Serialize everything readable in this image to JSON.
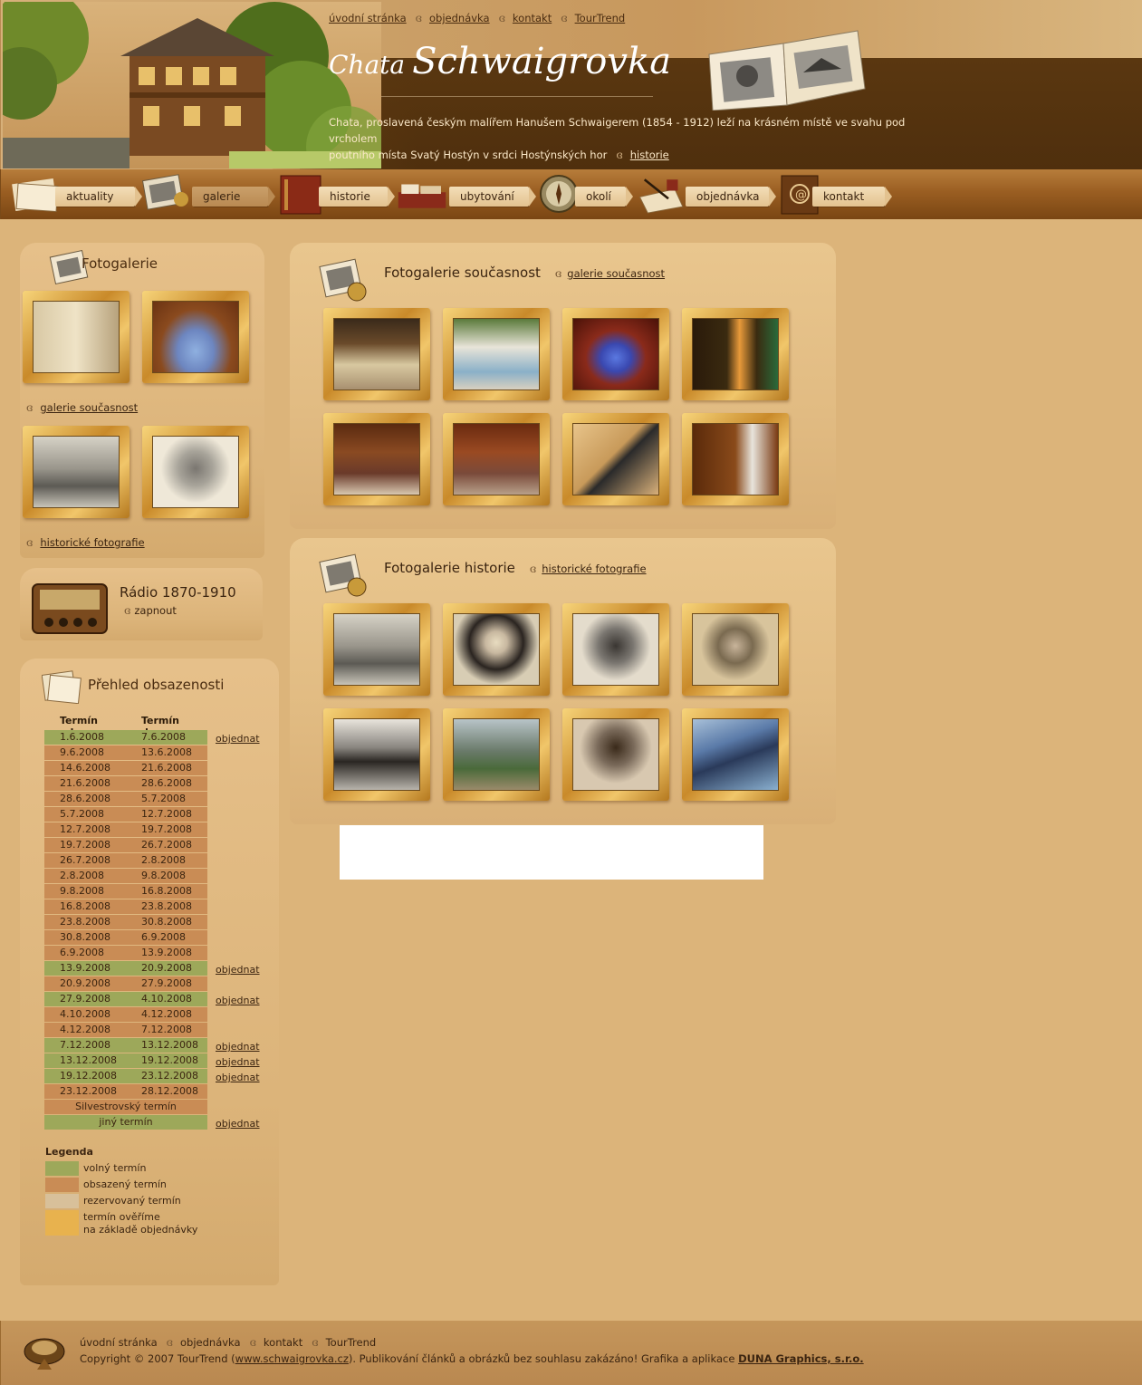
{
  "header": {
    "top_links": [
      "úvodní stránka",
      "objednávka",
      "kontakt",
      "TourTrend"
    ],
    "title_small": "Chata",
    "title_large": "Schwaigrovka",
    "intro_line1": "Chata, proslavená českým malířem Hanušem Schwaigerem (1854 - 1912) leží na krásném místě ve svahu pod vrcholem",
    "intro_line2": "poutního místa Svatý Hostýn v srdci Hostýnských hor",
    "intro_link": "historie"
  },
  "nav": [
    {
      "label": "aktuality",
      "icon": "papers-icon"
    },
    {
      "label": "galerie",
      "icon": "photos-icon",
      "active": true
    },
    {
      "label": "historie",
      "icon": "book-icon"
    },
    {
      "label": "ubytování",
      "icon": "bed-icon"
    },
    {
      "label": "okolí",
      "icon": "compass-icon"
    },
    {
      "label": "objednávka",
      "icon": "quill-icon"
    },
    {
      "label": "kontakt",
      "icon": "address-book-icon"
    }
  ],
  "sidebar": {
    "gallery_title": "Fotogalerie",
    "gallery_link_present": "galerie současnost",
    "gallery_link_history": "historické fotografie",
    "radio_title": "Rádio 1870-1910",
    "radio_action": "zapnout",
    "occupancy_title": "Přehled obsazenosti",
    "col_from": "Termín od",
    "col_to": "Termín do",
    "order_label": "objednat",
    "rows": [
      {
        "from": "1.6.2008",
        "to": "7.6.2008",
        "free": true
      },
      {
        "from": "9.6.2008",
        "to": "13.6.2008",
        "free": false
      },
      {
        "from": "14.6.2008",
        "to": "21.6.2008",
        "free": false
      },
      {
        "from": "21.6.2008",
        "to": "28.6.2008",
        "free": false
      },
      {
        "from": "28.6.2008",
        "to": "5.7.2008",
        "free": false
      },
      {
        "from": "5.7.2008",
        "to": "12.7.2008",
        "free": false
      },
      {
        "from": "12.7.2008",
        "to": "19.7.2008",
        "free": false
      },
      {
        "from": "19.7.2008",
        "to": "26.7.2008",
        "free": false
      },
      {
        "from": "26.7.2008",
        "to": "2.8.2008",
        "free": false
      },
      {
        "from": "2.8.2008",
        "to": "9.8.2008",
        "free": false
      },
      {
        "from": "9.8.2008",
        "to": "16.8.2008",
        "free": false
      },
      {
        "from": "16.8.2008",
        "to": "23.8.2008",
        "free": false
      },
      {
        "from": "23.8.2008",
        "to": "30.8.2008",
        "free": false
      },
      {
        "from": "30.8.2008",
        "to": "6.9.2008",
        "free": false
      },
      {
        "from": "6.9.2008",
        "to": "13.9.2008",
        "free": false
      },
      {
        "from": "13.9.2008",
        "to": "20.9.2008",
        "free": true
      },
      {
        "from": "20.9.2008",
        "to": "27.9.2008",
        "free": false
      },
      {
        "from": "27.9.2008",
        "to": "4.10.2008",
        "free": true
      },
      {
        "from": "4.10.2008",
        "to": "4.12.2008",
        "free": false
      },
      {
        "from": "4.12.2008",
        "to": "7.12.2008",
        "free": false
      },
      {
        "from": "7.12.2008",
        "to": "13.12.2008",
        "free": true
      },
      {
        "from": "13.12.2008",
        "to": "19.12.2008",
        "free": true
      },
      {
        "from": "19.12.2008",
        "to": "23.12.2008",
        "free": true
      },
      {
        "from": "23.12.2008",
        "to": "28.12.2008",
        "free": false
      },
      {
        "whole": "Silvestrovský termín",
        "free": false
      },
      {
        "whole": "jiný termín",
        "free": true
      }
    ],
    "legend_title": "Legenda",
    "legend": [
      {
        "label": "volný termín",
        "color": "#9da85a"
      },
      {
        "label": "obsazený termín",
        "color": "#c98c55"
      },
      {
        "label": "rezervovaný termín",
        "color": "#d8c09a"
      },
      {
        "label": "termín ověříme",
        "label2": "na základě objednávky",
        "color": "#e8b24e"
      }
    ]
  },
  "content": {
    "present_title": "Fotogalerie současnost",
    "present_link": "galerie současnost",
    "history_title": "Fotogalerie historie",
    "history_link": "historické fotografie"
  },
  "footer": {
    "links": [
      "úvodní stránka",
      "objednávka",
      "kontakt",
      "TourTrend"
    ],
    "copyright_pre": "Copyright © 2007 TourTrend (",
    "copyright_url": "www.schwaigrovka.cz",
    "copyright_post": "). Publikování článků a obrázků bez souhlasu zakázáno! Grafika a aplikace ",
    "credit": "DUNA Graphics, s.r.o."
  }
}
